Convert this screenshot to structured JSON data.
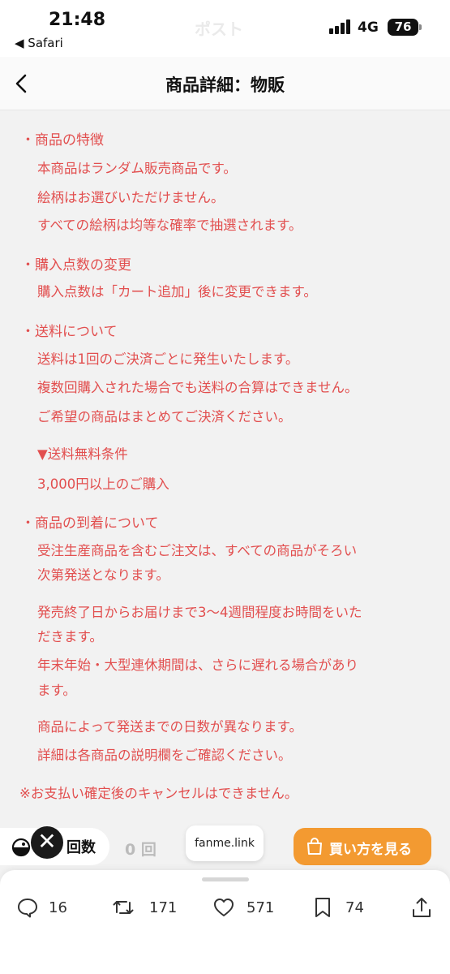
{
  "status_bar": {
    "time": "21:48",
    "back_app": "◀ Safari",
    "faded_title": "ポスト",
    "network": "4G",
    "battery": "76"
  },
  "header": {
    "title": "商品詳細：物販",
    "back_icon": "chevron-left-icon"
  },
  "sections": {
    "features": {
      "heading": "・商品の特徴",
      "lines": [
        "本商品はランダム販売商品です。",
        "絵柄はお選びいただけません。",
        "すべての絵柄は均等な確率で抽選されます。"
      ]
    },
    "quantity": {
      "heading": "・購入点数の変更",
      "lines": [
        "購入点数は「カート追加」後に変更できます。"
      ]
    },
    "shipping": {
      "heading": "・送料について",
      "lines": [
        "送料は1回のご決済ごとに発生いたします。",
        "複数回購入された場合でも送料の合算はできません。",
        "ご希望の商品はまとめてご決済ください。"
      ],
      "free_title": "▼送料無料条件",
      "free_condition": "3,000円以上のご購入"
    },
    "arrival": {
      "heading": "・商品の到着について",
      "lines": [
        "受注生産商品を含むご注文は、すべての商品がそろい",
        "次第発送となります。",
        "発売終了日からお届けまで3〜4週間程度お時間をいた",
        "だきます。",
        "年末年始・大型連休期間は、さらに遅れる場合があり",
        "ます。",
        "商品によって発送までの日数が異なります。",
        "詳細は各商品の説明欄をご確認ください。"
      ]
    },
    "note": "※お支払い確定後のキャンセルはできません。"
  },
  "purchase_bar": {
    "close_glyph": "✕",
    "count_label": "回数",
    "count_value": "0 回",
    "site": "fanme.link",
    "buy_label": "買い方を見る"
  },
  "actions": {
    "replies": "16",
    "reposts": "171",
    "likes": "571",
    "bookmarks": "74"
  },
  "colors": {
    "text_red": "#e24f4f",
    "buy_orange": "#f39a31",
    "background": "#f2f2f2"
  }
}
